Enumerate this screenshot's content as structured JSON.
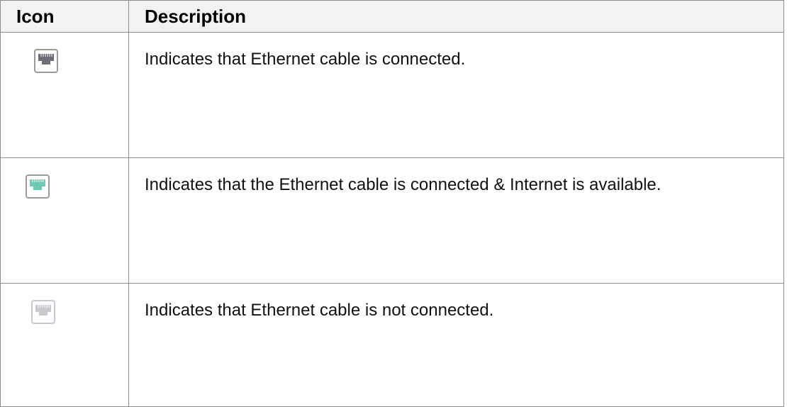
{
  "table": {
    "headers": {
      "icon": "Icon",
      "description": "Description"
    },
    "rows": [
      {
        "icon": "ethernet-connected-icon",
        "icon_color": "#6d6e79",
        "description": "Indicates that Ethernet cable is connected."
      },
      {
        "icon": "ethernet-internet-available-icon",
        "icon_color": "#6fc9b2",
        "description": "Indicates that the Ethernet cable is connected & Internet is available."
      },
      {
        "icon": "ethernet-disconnected-icon",
        "icon_color": "#c8c8cf",
        "description": "Indicates that Ethernet cable is not connected."
      }
    ]
  }
}
